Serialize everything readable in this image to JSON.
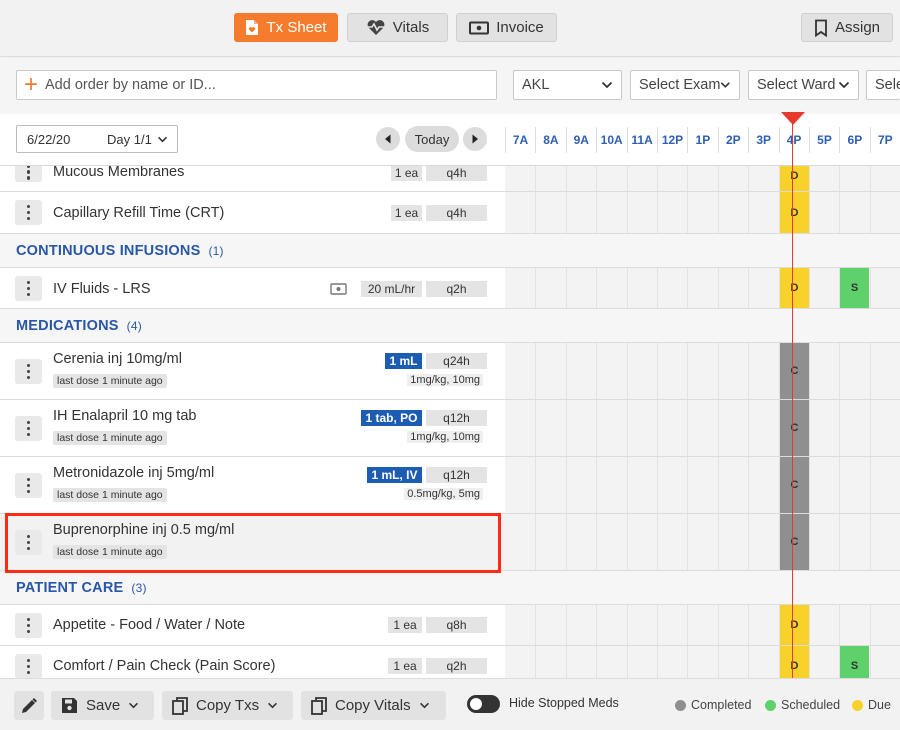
{
  "tabs": [
    {
      "label": "Tx Sheet",
      "icon": "tx-sheet-icon",
      "active": true
    },
    {
      "label": "Vitals",
      "icon": "heart-pulse-icon",
      "active": false
    },
    {
      "label": "Invoice",
      "icon": "cash-icon",
      "active": false
    }
  ],
  "assign_label": "Assign",
  "add_order_placeholder": "Add order by name or ID...",
  "filters": {
    "clinic": "AKL",
    "exam": "Select Exam",
    "ward": "Select Ward",
    "extra": "Sele"
  },
  "date": {
    "value": "6/22/20",
    "day": "Day 1/1",
    "today_label": "Today"
  },
  "hours": [
    "7A",
    "8A",
    "9A",
    "10A",
    "11A",
    "12P",
    "1P",
    "2P",
    "3P",
    "4P",
    "5P",
    "6P",
    "7P"
  ],
  "rows": {
    "mucous": {
      "name": "Mucous Membranes",
      "qty": "1 ea",
      "freq": "q4h",
      "block": "D"
    },
    "crt": {
      "name": "Capillary Refill Time (CRT)",
      "qty": "1 ea",
      "freq": "q4h",
      "block": "D"
    },
    "infusions_section": {
      "title": "CONTINUOUS INFUSIONS",
      "count": "(1)"
    },
    "ivfluids": {
      "name": "IV Fluids - LRS",
      "qty": "20 mL/hr",
      "freq": "q2h",
      "block": "D",
      "block2": "S"
    },
    "medications_section": {
      "title": "MEDICATIONS",
      "count": "(4)"
    },
    "cerenia": {
      "name": "Cerenia inj 10mg/ml",
      "last_dose": "last dose 1 minute ago",
      "dose": "1 mL",
      "freq": "q24h",
      "sub": "1mg/kg, 10mg",
      "block": "C"
    },
    "enalapril": {
      "name": "IH Enalapril 10 mg tab",
      "last_dose": "last dose 1 minute ago",
      "dose": "1 tab, PO",
      "freq": "q12h",
      "sub": "1mg/kg, 10mg",
      "block": "C"
    },
    "metronidazole": {
      "name": "Metronidazole inj 5mg/ml",
      "last_dose": "last dose 1 minute ago",
      "dose": "1 mL, IV",
      "freq": "q12h",
      "sub": "0.5mg/kg, 5mg",
      "block": "C"
    },
    "buprenorphine": {
      "name": "Buprenorphine inj 0.5 mg/ml",
      "last_dose": "last dose 1 minute ago",
      "block": "C"
    },
    "patientcare_section": {
      "title": "PATIENT CARE",
      "count": "(3)"
    },
    "appetite": {
      "name": "Appetite - Food / Water / Note",
      "qty": "1 ea",
      "freq": "q8h",
      "block": "D"
    },
    "comfort": {
      "name": "Comfort / Pain Check (Pain Score)",
      "qty": "1 ea",
      "freq": "q2h",
      "block": "D",
      "block2": "S"
    }
  },
  "bottom": {
    "save": "Save",
    "copy_txs": "Copy Txs",
    "copy_vitals": "Copy Vitals",
    "hide_stopped": "Hide Stopped Meds"
  },
  "legend": [
    {
      "label": "Completed",
      "color": "#8f8f8f"
    },
    {
      "label": "Scheduled",
      "color": "#5fd16a"
    },
    {
      "label": "Due",
      "color": "#f9d12b"
    }
  ],
  "colors": {
    "accent": "#f47c2c",
    "section_blue": "#2957a8",
    "dose_blue": "#1c5cb3",
    "now_line": "#e63a2e"
  }
}
